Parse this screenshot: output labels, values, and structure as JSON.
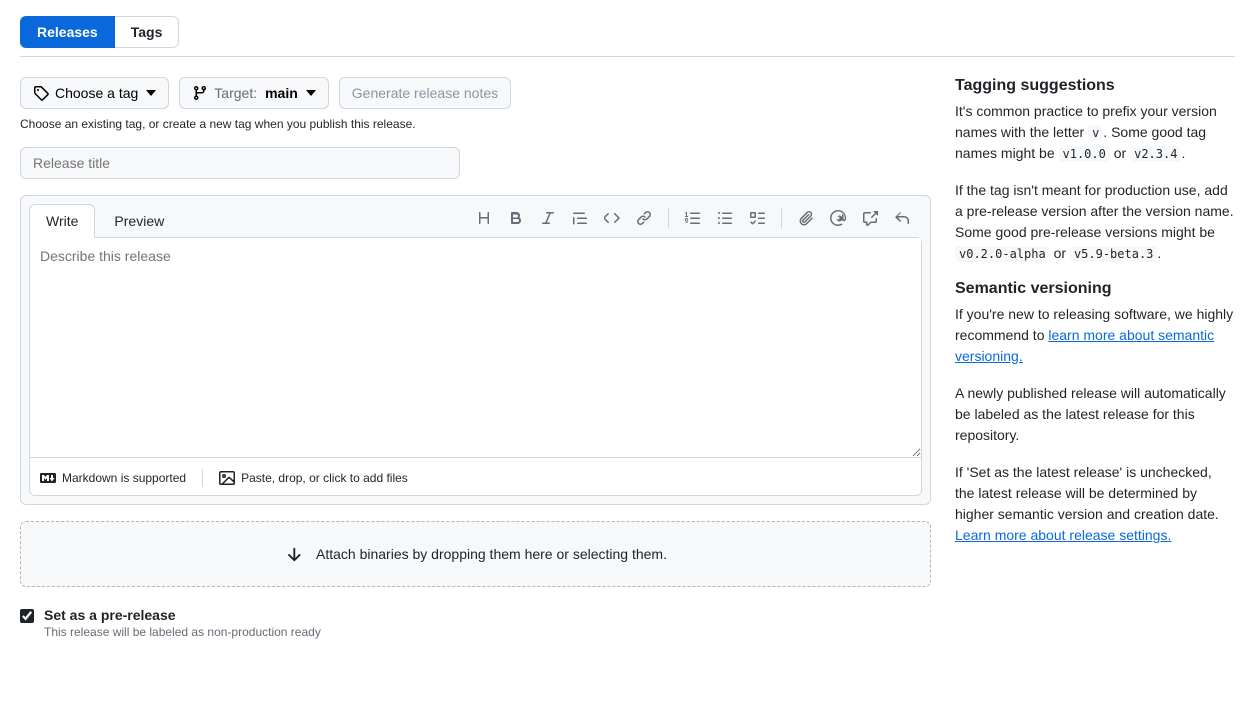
{
  "nav": {
    "releases": "Releases",
    "tags": "Tags"
  },
  "toolbar": {
    "choose_tag": "Choose a tag",
    "target_label": "Target:",
    "target_value": "main",
    "generate_notes": "Generate release notes",
    "hint": "Choose an existing tag, or create a new tag when you publish this release."
  },
  "form": {
    "title_placeholder": "Release title",
    "description_placeholder": "Describe this release"
  },
  "editor": {
    "tabs": {
      "write": "Write",
      "preview": "Preview"
    },
    "footer": {
      "markdown": "Markdown is supported",
      "files": "Paste, drop, or click to add files"
    }
  },
  "dropzone": {
    "label": "Attach binaries by dropping them here or selecting them."
  },
  "prerelease": {
    "label": "Set as a pre-release",
    "description": "This release will be labeled as non-production ready"
  },
  "sidebar": {
    "tagging": {
      "heading": "Tagging suggestions",
      "p1_a": "It's common practice to prefix your version names with the letter ",
      "p1_code1": "v",
      "p1_b": ". Some good tag names might be ",
      "p1_code2": "v1.0.0",
      "p1_c": " or ",
      "p1_code3": "v2.3.4",
      "p1_d": ".",
      "p2_a": "If the tag isn't meant for production use, add a pre-release version after the version name. Some good pre-release versions might be ",
      "p2_code1": "v0.2.0-alpha",
      "p2_b": " or ",
      "p2_code2": "v5.9-beta.3",
      "p2_c": "."
    },
    "semver": {
      "heading": "Semantic versioning",
      "p1_a": "If you're new to releasing software, we highly recommend to ",
      "p1_link": "learn more about semantic versioning.",
      "p2": "A newly published release will automatically be labeled as the latest release for this repository.",
      "p3_a": "If 'Set as the latest release' is unchecked, the latest release will be determined by higher semantic version and creation date. ",
      "p3_link": "Learn more about release settings."
    }
  }
}
